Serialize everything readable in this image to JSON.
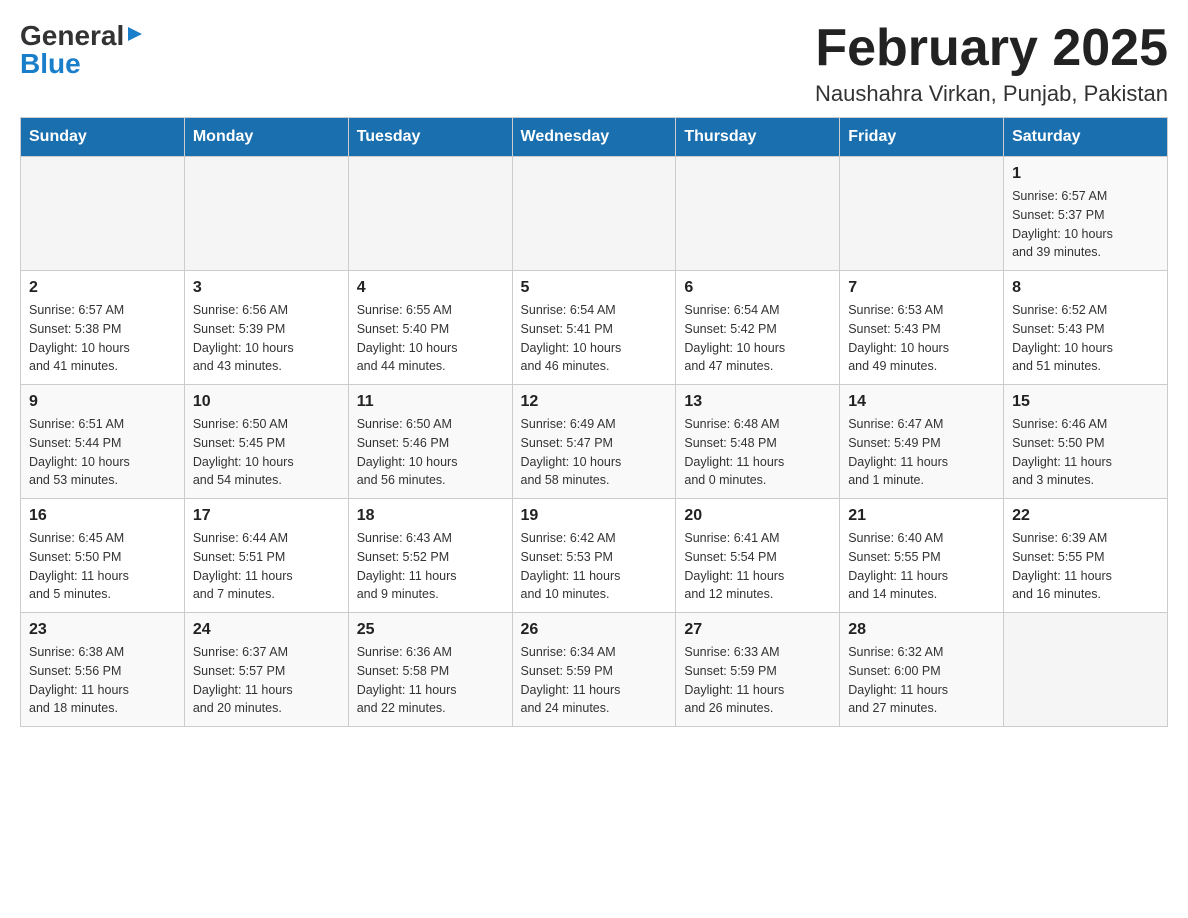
{
  "header": {
    "logo_general": "General",
    "logo_blue": "Blue",
    "month_title": "February 2025",
    "location": "Naushahra Virkan, Punjab, Pakistan"
  },
  "weekdays": [
    "Sunday",
    "Monday",
    "Tuesday",
    "Wednesday",
    "Thursday",
    "Friday",
    "Saturday"
  ],
  "weeks": [
    [
      {
        "day": "",
        "info": ""
      },
      {
        "day": "",
        "info": ""
      },
      {
        "day": "",
        "info": ""
      },
      {
        "day": "",
        "info": ""
      },
      {
        "day": "",
        "info": ""
      },
      {
        "day": "",
        "info": ""
      },
      {
        "day": "1",
        "info": "Sunrise: 6:57 AM\nSunset: 5:37 PM\nDaylight: 10 hours\nand 39 minutes."
      }
    ],
    [
      {
        "day": "2",
        "info": "Sunrise: 6:57 AM\nSunset: 5:38 PM\nDaylight: 10 hours\nand 41 minutes."
      },
      {
        "day": "3",
        "info": "Sunrise: 6:56 AM\nSunset: 5:39 PM\nDaylight: 10 hours\nand 43 minutes."
      },
      {
        "day": "4",
        "info": "Sunrise: 6:55 AM\nSunset: 5:40 PM\nDaylight: 10 hours\nand 44 minutes."
      },
      {
        "day": "5",
        "info": "Sunrise: 6:54 AM\nSunset: 5:41 PM\nDaylight: 10 hours\nand 46 minutes."
      },
      {
        "day": "6",
        "info": "Sunrise: 6:54 AM\nSunset: 5:42 PM\nDaylight: 10 hours\nand 47 minutes."
      },
      {
        "day": "7",
        "info": "Sunrise: 6:53 AM\nSunset: 5:43 PM\nDaylight: 10 hours\nand 49 minutes."
      },
      {
        "day": "8",
        "info": "Sunrise: 6:52 AM\nSunset: 5:43 PM\nDaylight: 10 hours\nand 51 minutes."
      }
    ],
    [
      {
        "day": "9",
        "info": "Sunrise: 6:51 AM\nSunset: 5:44 PM\nDaylight: 10 hours\nand 53 minutes."
      },
      {
        "day": "10",
        "info": "Sunrise: 6:50 AM\nSunset: 5:45 PM\nDaylight: 10 hours\nand 54 minutes."
      },
      {
        "day": "11",
        "info": "Sunrise: 6:50 AM\nSunset: 5:46 PM\nDaylight: 10 hours\nand 56 minutes."
      },
      {
        "day": "12",
        "info": "Sunrise: 6:49 AM\nSunset: 5:47 PM\nDaylight: 10 hours\nand 58 minutes."
      },
      {
        "day": "13",
        "info": "Sunrise: 6:48 AM\nSunset: 5:48 PM\nDaylight: 11 hours\nand 0 minutes."
      },
      {
        "day": "14",
        "info": "Sunrise: 6:47 AM\nSunset: 5:49 PM\nDaylight: 11 hours\nand 1 minute."
      },
      {
        "day": "15",
        "info": "Sunrise: 6:46 AM\nSunset: 5:50 PM\nDaylight: 11 hours\nand 3 minutes."
      }
    ],
    [
      {
        "day": "16",
        "info": "Sunrise: 6:45 AM\nSunset: 5:50 PM\nDaylight: 11 hours\nand 5 minutes."
      },
      {
        "day": "17",
        "info": "Sunrise: 6:44 AM\nSunset: 5:51 PM\nDaylight: 11 hours\nand 7 minutes."
      },
      {
        "day": "18",
        "info": "Sunrise: 6:43 AM\nSunset: 5:52 PM\nDaylight: 11 hours\nand 9 minutes."
      },
      {
        "day": "19",
        "info": "Sunrise: 6:42 AM\nSunset: 5:53 PM\nDaylight: 11 hours\nand 10 minutes."
      },
      {
        "day": "20",
        "info": "Sunrise: 6:41 AM\nSunset: 5:54 PM\nDaylight: 11 hours\nand 12 minutes."
      },
      {
        "day": "21",
        "info": "Sunrise: 6:40 AM\nSunset: 5:55 PM\nDaylight: 11 hours\nand 14 minutes."
      },
      {
        "day": "22",
        "info": "Sunrise: 6:39 AM\nSunset: 5:55 PM\nDaylight: 11 hours\nand 16 minutes."
      }
    ],
    [
      {
        "day": "23",
        "info": "Sunrise: 6:38 AM\nSunset: 5:56 PM\nDaylight: 11 hours\nand 18 minutes."
      },
      {
        "day": "24",
        "info": "Sunrise: 6:37 AM\nSunset: 5:57 PM\nDaylight: 11 hours\nand 20 minutes."
      },
      {
        "day": "25",
        "info": "Sunrise: 6:36 AM\nSunset: 5:58 PM\nDaylight: 11 hours\nand 22 minutes."
      },
      {
        "day": "26",
        "info": "Sunrise: 6:34 AM\nSunset: 5:59 PM\nDaylight: 11 hours\nand 24 minutes."
      },
      {
        "day": "27",
        "info": "Sunrise: 6:33 AM\nSunset: 5:59 PM\nDaylight: 11 hours\nand 26 minutes."
      },
      {
        "day": "28",
        "info": "Sunrise: 6:32 AM\nSunset: 6:00 PM\nDaylight: 11 hours\nand 27 minutes."
      },
      {
        "day": "",
        "info": ""
      }
    ]
  ]
}
